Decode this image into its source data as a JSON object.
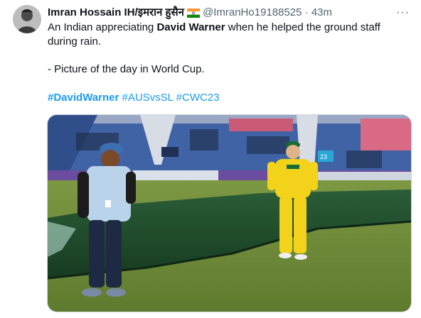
{
  "tweet": {
    "author_name": "Imran Hossain IH/इमरान हुसैन",
    "flag_icon": "india-flag",
    "handle": "@ImranHo19188525",
    "separator": "·",
    "time": "43m",
    "more_icon": "more-horizontal-icon",
    "text": {
      "line1_prefix": "An Indian appreciating ",
      "line1_bold": "David Warner",
      "line1_suffix": " when he helped the ground staff during rain.",
      "line2": "- Picture of the day in World Cup."
    },
    "hashtags": [
      "#DavidWarner",
      "#AUSvsSL",
      "#CWC23"
    ],
    "media": {
      "type": "photo",
      "scoreboard_text": "23",
      "colors": {
        "grass": "#6f8a3a",
        "cover": "#1f4a2b",
        "stands": "#3e63a8",
        "aus_kit": "#f2d21b",
        "staff_shirt": "#b9d3ea"
      }
    },
    "colors": {
      "link": "#1d9bf0",
      "secondary_text": "#536471",
      "primary_text": "#0f1419"
    }
  }
}
